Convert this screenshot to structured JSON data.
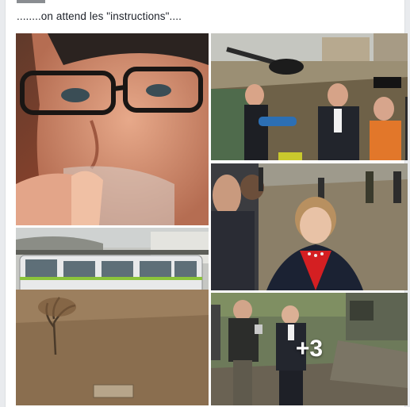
{
  "post": {
    "caption": "........on attend les \"instructions\"....",
    "photos": [
      {
        "name": "photo-man-glasses"
      },
      {
        "name": "photo-press-flood-street"
      },
      {
        "name": "photo-merkel-flood"
      },
      {
        "name": "photo-tram-flood"
      },
      {
        "name": "photo-hollande-flood"
      }
    ],
    "more_count": "+3"
  },
  "colors": {
    "page_bg": "#e9ebee",
    "card_bg": "#ffffff",
    "text": "#1d2129",
    "flood_water": "#8a6e4f",
    "merkel_jacket": "#d41f22"
  }
}
